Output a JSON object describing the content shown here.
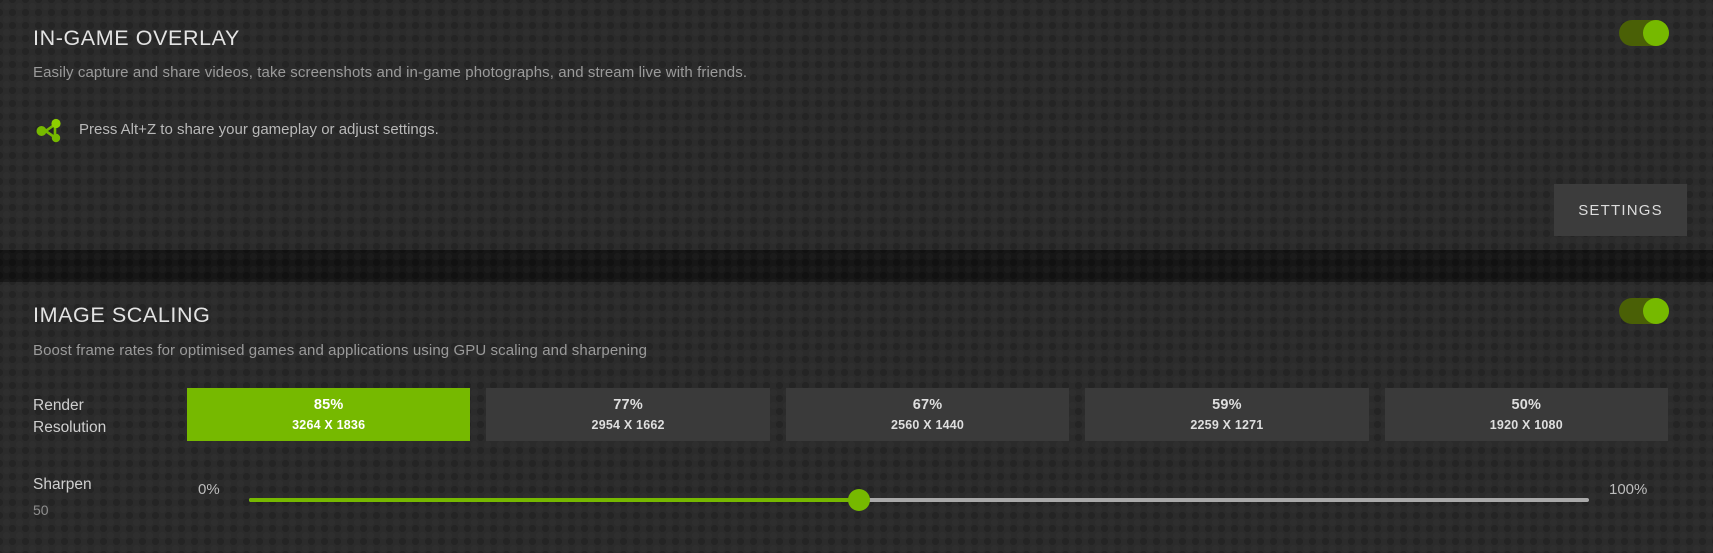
{
  "theme": {
    "accent_green": "#76b900",
    "background": "#2b2b2b",
    "panel": "#3a3a3a",
    "divider": "#161616",
    "track": "#a9a9a9"
  },
  "overlay_section": {
    "title": "IN-GAME OVERLAY",
    "description": "Easily capture and share videos, take screenshots and in-game photographs, and stream live with friends.",
    "hint_icon": "share-icon",
    "hint": "Press Alt+Z to share your gameplay or adjust settings.",
    "settings_label": "SETTINGS",
    "toggle": {
      "state": "on",
      "aria": "In-game overlay enabled"
    }
  },
  "scaling_section": {
    "title": "IMAGE SCALING",
    "description": "Boost frame rates for optimised games and applications using GPU scaling and sharpening",
    "toggle": {
      "state": "on",
      "aria": "Image scaling enabled"
    },
    "render_resolution": {
      "label_line1": "Render",
      "label_line2": "Resolution",
      "selected_index": 0,
      "options": [
        {
          "percent": "85%",
          "dimensions": "3264 X 1836"
        },
        {
          "percent": "77%",
          "dimensions": "2954 X 1662"
        },
        {
          "percent": "67%",
          "dimensions": "2560 X 1440"
        },
        {
          "percent": "59%",
          "dimensions": "2259 X 1271"
        },
        {
          "percent": "50%",
          "dimensions": "1920 X 1080"
        }
      ]
    },
    "sharpen": {
      "label": "Sharpen",
      "value": "50",
      "min_label": "0%",
      "max_label": "100%",
      "fill_percent": 45.5
    }
  }
}
